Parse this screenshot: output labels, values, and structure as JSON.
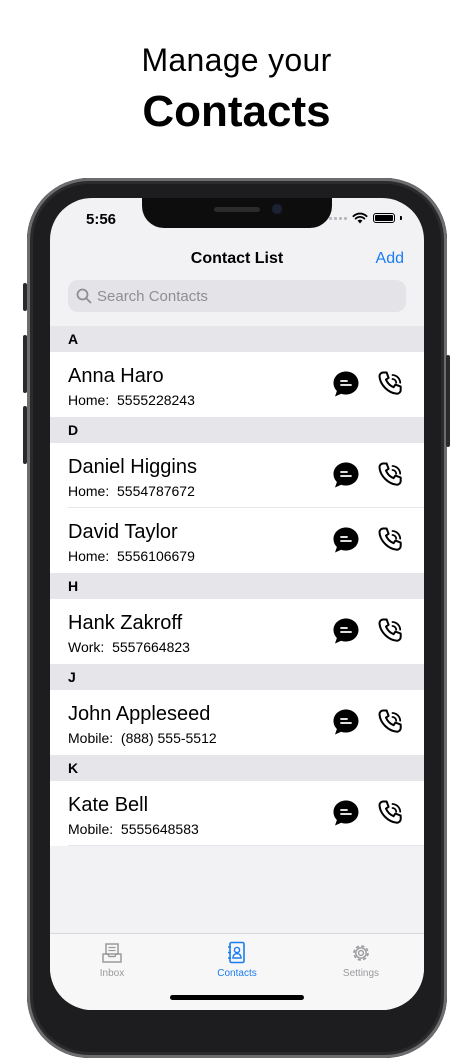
{
  "promo": {
    "line1": "Manage your",
    "line2": "Contacts"
  },
  "status": {
    "time": "5:56"
  },
  "nav": {
    "title": "Contact List",
    "add_label": "Add"
  },
  "search": {
    "placeholder": "Search Contacts"
  },
  "sections": [
    {
      "letter": "A",
      "contacts": [
        {
          "name": "Anna Haro",
          "label": "Home:",
          "number": "5555228243"
        }
      ]
    },
    {
      "letter": "D",
      "contacts": [
        {
          "name": "Daniel Higgins",
          "label": "Home:",
          "number": "5554787672"
        },
        {
          "name": "David Taylor",
          "label": "Home:",
          "number": "5556106679"
        }
      ]
    },
    {
      "letter": "H",
      "contacts": [
        {
          "name": "Hank Zakroff",
          "label": "Work:",
          "number": "5557664823"
        }
      ]
    },
    {
      "letter": "J",
      "contacts": [
        {
          "name": "John Appleseed",
          "label": "Mobile:",
          "number": "(888) 555-5512"
        }
      ]
    },
    {
      "letter": "K",
      "contacts": [
        {
          "name": "Kate Bell",
          "label": "Mobile:",
          "number": "5555648583"
        }
      ]
    }
  ],
  "tabs": [
    {
      "label": "Inbox",
      "icon": "inbox-icon",
      "active": false
    },
    {
      "label": "Contacts",
      "icon": "contacts-book-icon",
      "active": true
    },
    {
      "label": "Settings",
      "icon": "gear-icon",
      "active": false
    }
  ],
  "colors": {
    "accent": "#1a7cf2",
    "section_bg": "#e5e5ea",
    "screen_bg": "#f2f2f4"
  }
}
